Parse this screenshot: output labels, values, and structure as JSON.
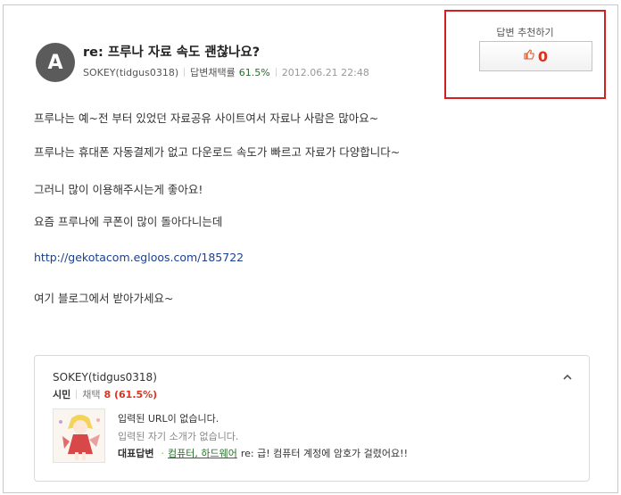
{
  "question": {
    "avatar_letter": "A",
    "title": "re: 프루나 자료 속도 괜찮나요?",
    "author": "SOKEY(tidgus0318)",
    "adoption_label": "답변채택률",
    "adoption_rate": "61.5%",
    "date": "2012.06.21 22:48"
  },
  "recommend": {
    "label": "답변 추천하기",
    "count": "0",
    "icon": "thumbs-up-icon"
  },
  "content": {
    "lines": [
      "프루나는 예~전 부터 있었던 자료공유 사이트여서 자료나 사람은 많아요~",
      "프루나는 휴대폰 자동결제가 없고 다운로드 속도가 빠르고 자료가 다양합니다~",
      "그러니 많이 이용해주시는게 좋아요!",
      "요즘 프루나에 쿠폰이 많이 돌아다니는데",
      "http://gekotacom.egloos.com/185722",
      "여기 블로그에서 받아가세요~"
    ]
  },
  "profile": {
    "name": "SOKEY(tidgus0318)",
    "grade": "시민",
    "adopt_label": "채택",
    "adopt_count": "8 (61.5%)",
    "url_text": "입력된 URL이 없습니다.",
    "intro_text": "입력된 자기 소개가 없습니다.",
    "best_label": "대표답변",
    "best_category": "컴퓨터, 하드웨어",
    "best_question": "re: 급! 컴퓨터 계정에 암호가 걸렸어요!!",
    "collapse_icon": "chevron-up-icon",
    "colors": {
      "accent_red": "#d8341f",
      "accent_green": "#2a6e2a",
      "link_blue": "#1b3f91",
      "highlight_box": "#d41f1f"
    }
  }
}
